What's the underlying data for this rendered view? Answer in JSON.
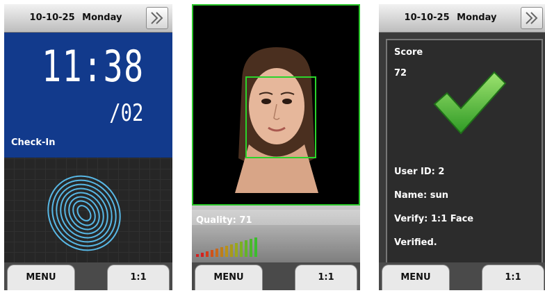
{
  "panel1": {
    "date": "10-10-25",
    "day": "Monday",
    "time": "11:38",
    "date_small": "/02",
    "status": "Check-In",
    "menu": "MENU",
    "mode": "1:1"
  },
  "panel2": {
    "quality": "Quality: 71",
    "menu": "MENU",
    "mode": "1:1"
  },
  "panel3": {
    "date": "10-10-25",
    "day": "Monday",
    "score_label": "Score",
    "score_value": "72",
    "user_id": "User ID: 2",
    "name": "Name: sun",
    "verify": "Verify: 1:1 Face",
    "result": "Verified.",
    "menu": "MENU",
    "mode": "1:1"
  },
  "colors": {
    "clock_bg": "#123a8c",
    "face_frame": "#2bd42b",
    "check": "#4fc13a"
  }
}
